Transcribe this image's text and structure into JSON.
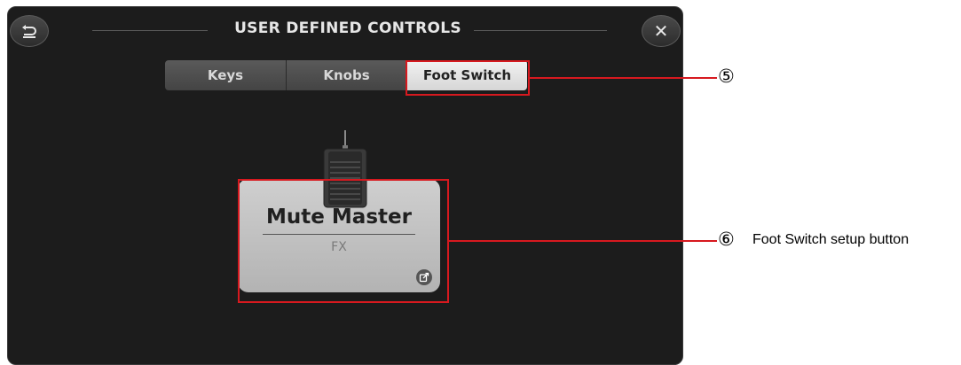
{
  "header": {
    "title": "USER DEFINED CONTROLS",
    "back_icon": "return-arrow-icon",
    "close_icon": "close-icon",
    "close_glyph": "✕"
  },
  "tabs": [
    {
      "label": "Keys",
      "selected": false
    },
    {
      "label": "Knobs",
      "selected": false
    },
    {
      "label": "Foot Switch",
      "selected": true
    }
  ],
  "foot_switch": {
    "function_name": "Mute Master",
    "parameter": "FX",
    "edit_icon": "external-edit-icon",
    "pedal_icon": "foot-pedal-icon"
  },
  "annotations": {
    "tab_callout_number": "⑤",
    "button_callout_number": "⑥",
    "button_callout_text": "Foot Switch setup button",
    "highlight_color": "#d7191f"
  },
  "colors": {
    "screen_background": "#1c1c1c",
    "selected_tab": "#e6e6e6",
    "unselected_tab": "#4e4e4e",
    "setup_button": "#c2c2c2"
  }
}
